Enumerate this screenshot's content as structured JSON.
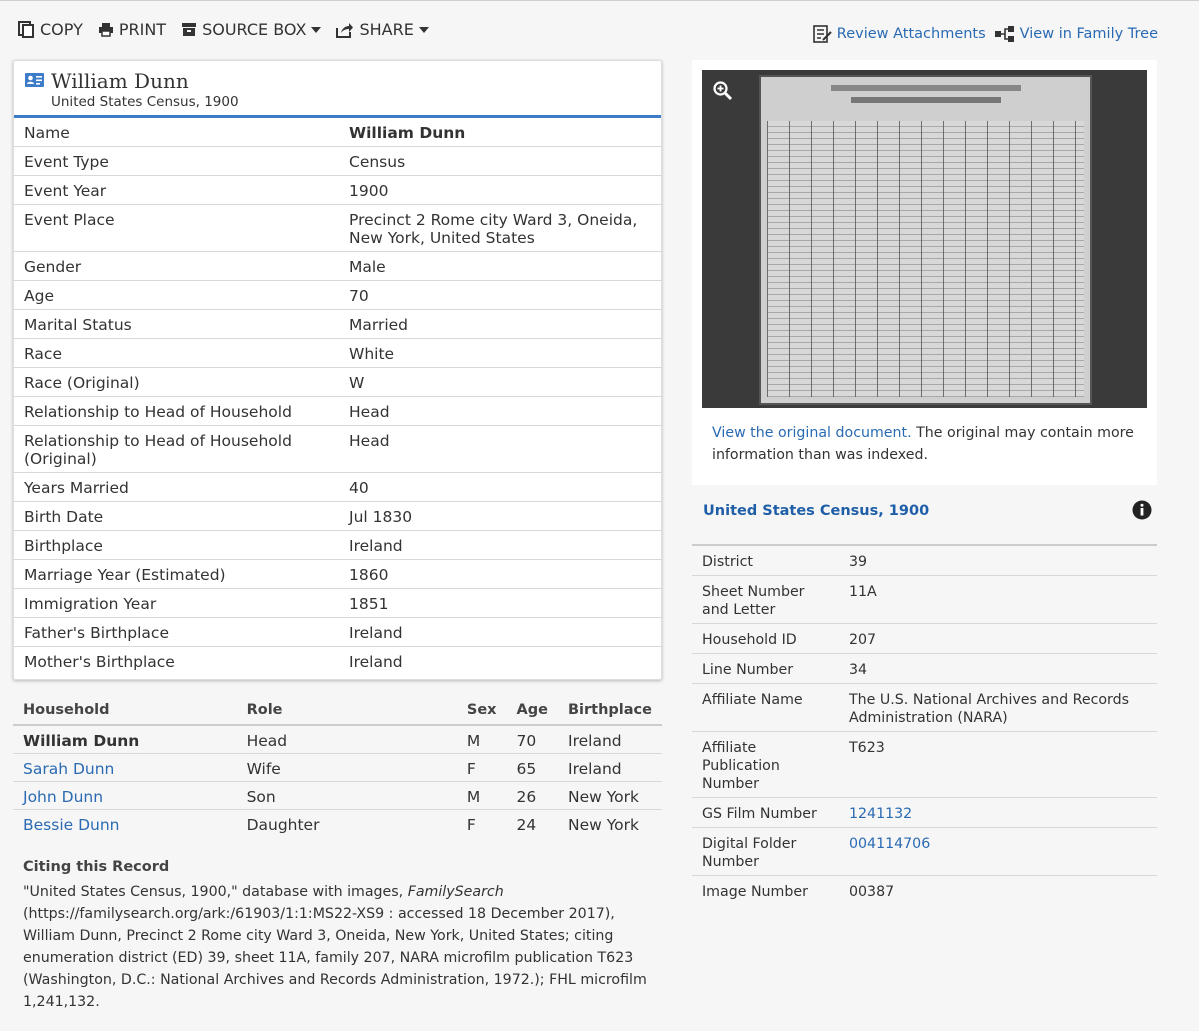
{
  "toolbar": {
    "copy": "COPY",
    "print": "PRINT",
    "source_box": "SOURCE BOX",
    "share": "SHARE",
    "review_attachments": "Review Attachments",
    "view_family_tree": "View in Family Tree"
  },
  "record": {
    "title": "William Dunn",
    "subtitle": "United States Census, 1900",
    "facts": [
      {
        "label": "Name",
        "value": "William Dunn"
      },
      {
        "label": "Event Type",
        "value": "Census"
      },
      {
        "label": "Event Year",
        "value": "1900"
      },
      {
        "label": "Event Place",
        "value": "Precinct 2 Rome city Ward 3, Oneida, New York, United States"
      },
      {
        "label": "Gender",
        "value": "Male"
      },
      {
        "label": "Age",
        "value": "70"
      },
      {
        "label": "Marital Status",
        "value": "Married"
      },
      {
        "label": "Race",
        "value": "White"
      },
      {
        "label": "Race (Original)",
        "value": "W"
      },
      {
        "label": "Relationship to Head of Household",
        "value": "Head"
      },
      {
        "label": "Relationship to Head of Household (Original)",
        "value": "Head"
      },
      {
        "label": "Years Married",
        "value": "40"
      },
      {
        "label": "Birth Date",
        "value": "Jul 1830"
      },
      {
        "label": "Birthplace",
        "value": "Ireland"
      },
      {
        "label": "Marriage Year (Estimated)",
        "value": "1860"
      },
      {
        "label": "Immigration Year",
        "value": "1851"
      },
      {
        "label": "Father's Birthplace",
        "value": "Ireland"
      },
      {
        "label": "Mother's Birthplace",
        "value": "Ireland"
      }
    ]
  },
  "household": {
    "headers": {
      "name": "Household",
      "role": "Role",
      "sex": "Sex",
      "age": "Age",
      "birthplace": "Birthplace"
    },
    "members": [
      {
        "name": "William Dunn",
        "role": "Head",
        "sex": "M",
        "age": "70",
        "birthplace": "Ireland"
      },
      {
        "name": "Sarah Dunn",
        "role": "Wife",
        "sex": "F",
        "age": "65",
        "birthplace": "Ireland"
      },
      {
        "name": "John Dunn",
        "role": "Son",
        "sex": "M",
        "age": "26",
        "birthplace": "New York"
      },
      {
        "name": "Bessie Dunn",
        "role": "Daughter",
        "sex": "F",
        "age": "24",
        "birthplace": "New York"
      }
    ]
  },
  "citation": {
    "heading": "Citing this Record",
    "part1": "\"United States Census, 1900,\" database with images, ",
    "source": "FamilySearch",
    "part2": " (https://familysearch.org/ark:/61903/1:1:MS22-XS9 : accessed 18 December 2017), William Dunn, Precinct 2 Rome city Ward 3, Oneida, New York, United States; citing enumeration district (ED) 39, sheet 11A, family 207, NARA microfilm publication T623 (Washington, D.C.: National Archives and Records Administration, 1972.); FHL microfilm 1,241,132."
  },
  "image_panel": {
    "link": "View the original document.",
    "note": " The original may contain more information than was indexed."
  },
  "collection": {
    "title": "United States Census, 1900",
    "fields": [
      {
        "label": "District",
        "value": "39"
      },
      {
        "label": "Sheet Number and Letter",
        "value": "11A"
      },
      {
        "label": "Household ID",
        "value": "207"
      },
      {
        "label": "Line Number",
        "value": "34"
      },
      {
        "label": "Affiliate Name",
        "value": "The U.S. National Archives and Records Administration (NARA)"
      },
      {
        "label": "Affiliate Publication Number",
        "value": "T623"
      },
      {
        "label": "GS Film Number",
        "value": "1241132"
      },
      {
        "label": "Digital Folder Number",
        "value": "004114706"
      },
      {
        "label": "Image Number",
        "value": "00387"
      }
    ]
  },
  "colors": {
    "link": "#2a6ab3",
    "accent": "#3d7cc9"
  }
}
